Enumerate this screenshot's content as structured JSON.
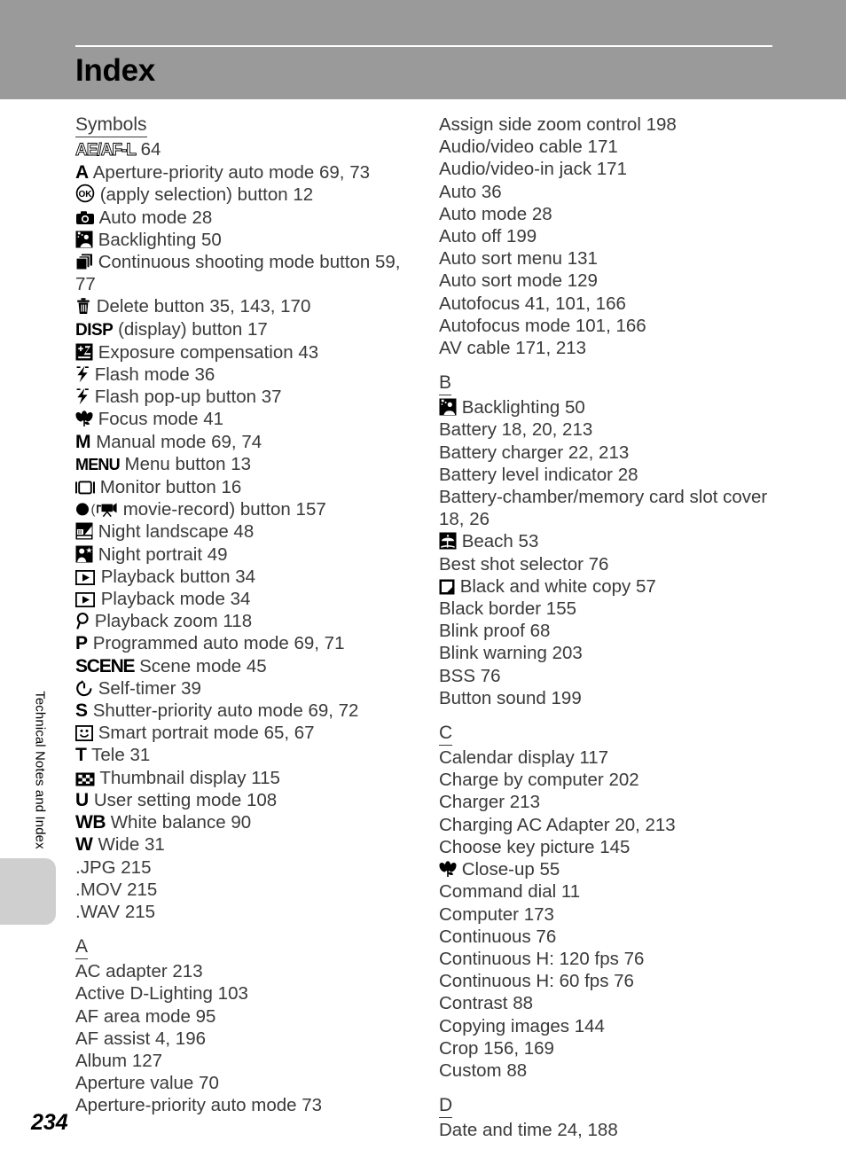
{
  "page": {
    "title": "Index",
    "number": "234",
    "side_tab_label": "Technical Notes and Index",
    "header_bg": "#9a9a9a",
    "text_color": "#3a3a3a",
    "tab_color": "#cfcfcf"
  },
  "left_column": {
    "headings": {
      "symbols": "Symbols",
      "a": "A"
    },
    "symbol_entries": [
      {
        "icon": "ae-af-l-icon",
        "label": "",
        "pages": "64"
      },
      {
        "icon": "letter-a-icon",
        "label": "Aperture-priority auto mode",
        "pages": "69, 73"
      },
      {
        "icon": "ok-button-icon",
        "label": "(apply selection) button",
        "pages": "12"
      },
      {
        "icon": "camera-auto-mode-icon",
        "label": "Auto mode",
        "pages": "28"
      },
      {
        "icon": "backlighting-icon",
        "label": "Backlighting",
        "pages": "50"
      },
      {
        "icon": "continuous-shooting-icon",
        "label": "Continuous shooting mode button",
        "pages": "59, 77"
      },
      {
        "icon": "trash-delete-icon",
        "label": "Delete button",
        "pages": "35, 143, 170"
      },
      {
        "icon": "disp-icon",
        "label": "(display) button",
        "pages": "17"
      },
      {
        "icon": "exposure-compensation-icon",
        "label": "Exposure compensation",
        "pages": "43"
      },
      {
        "icon": "flash-icon",
        "label": "Flash mode",
        "pages": "36"
      },
      {
        "icon": "flash-popup-icon",
        "label": "Flash pop-up button",
        "pages": "37"
      },
      {
        "icon": "macro-flower-icon",
        "label": "Focus mode",
        "pages": "41"
      },
      {
        "icon": "letter-m-icon",
        "label": "Manual mode",
        "pages": "69, 74"
      },
      {
        "icon": "menu-icon",
        "label": "Menu button",
        "pages": "13"
      },
      {
        "icon": "monitor-icon",
        "label": "Monitor button",
        "pages": "16"
      },
      {
        "icon": "movie-record-icon",
        "label": "movie-record) button",
        "pages": "157"
      },
      {
        "icon": "night-landscape-icon",
        "label": "Night landscape",
        "pages": "48"
      },
      {
        "icon": "night-portrait-icon",
        "label": "Night portrait",
        "pages": "49"
      },
      {
        "icon": "playback-icon",
        "label": "Playback button",
        "pages": "34"
      },
      {
        "icon": "playback-icon",
        "label": "Playback mode",
        "pages": "34"
      },
      {
        "icon": "magnifier-zoom-icon",
        "label": "Playback zoom",
        "pages": "118"
      },
      {
        "icon": "letter-p-icon",
        "label": "Programmed auto mode",
        "pages": "69, 71"
      },
      {
        "icon": "scene-icon",
        "label": "Scene mode",
        "pages": "45"
      },
      {
        "icon": "self-timer-icon",
        "label": "Self-timer",
        "pages": "39"
      },
      {
        "icon": "letter-s-icon",
        "label": "Shutter-priority auto mode",
        "pages": "69, 72"
      },
      {
        "icon": "smile-portrait-icon",
        "label": "Smart portrait mode",
        "pages": "65, 67"
      },
      {
        "icon": "letter-t-icon",
        "label": "Tele",
        "pages": "31"
      },
      {
        "icon": "thumbnail-display-icon",
        "label": "Thumbnail display",
        "pages": "115"
      },
      {
        "icon": "letter-u-icon",
        "label": "User setting mode",
        "pages": "108"
      },
      {
        "icon": "wb-icon",
        "label": "White balance",
        "pages": "90"
      },
      {
        "icon": "letter-w-icon",
        "label": "Wide",
        "pages": "31"
      },
      {
        "icon": "",
        "label": ".JPG",
        "pages": "215"
      },
      {
        "icon": "",
        "label": ".MOV",
        "pages": "215"
      },
      {
        "icon": "",
        "label": ".WAV",
        "pages": "215"
      }
    ],
    "a_entries": [
      {
        "label": "AC adapter",
        "pages": "213"
      },
      {
        "label": "Active D-Lighting",
        "pages": "103"
      },
      {
        "label": "AF area mode",
        "pages": "95"
      },
      {
        "label": "AF assist",
        "pages": "4, 196"
      },
      {
        "label": "Album",
        "pages": "127"
      },
      {
        "label": "Aperture value",
        "pages": "70"
      },
      {
        "label": "Aperture-priority auto mode",
        "pages": "73"
      }
    ]
  },
  "right_column": {
    "headings": {
      "b": "B",
      "c": "C",
      "d": "D"
    },
    "a_cont_entries": [
      {
        "label": "Assign side zoom control",
        "pages": "198"
      },
      {
        "label": "Audio/video cable",
        "pages": "171"
      },
      {
        "label": "Audio/video-in jack",
        "pages": "171"
      },
      {
        "label": "Auto",
        "pages": "36"
      },
      {
        "label": "Auto mode",
        "pages": "28"
      },
      {
        "label": "Auto off",
        "pages": "199"
      },
      {
        "label": "Auto sort menu",
        "pages": "131"
      },
      {
        "label": "Auto sort mode",
        "pages": "129"
      },
      {
        "label": "Autofocus",
        "pages": "41, 101, 166"
      },
      {
        "label": "Autofocus mode",
        "pages": "101, 166"
      },
      {
        "label": "AV cable",
        "pages": "171, 213"
      }
    ],
    "b_entries": [
      {
        "label": "Backlighting",
        "icon": "backlighting-icon",
        "pages": "50"
      },
      {
        "label": "Battery",
        "icon": "",
        "pages": "18, 20, 213"
      },
      {
        "label": "Battery charger",
        "icon": "",
        "pages": "22, 213"
      },
      {
        "label": "Battery level indicator",
        "icon": "",
        "pages": "28"
      },
      {
        "label": "Battery-chamber/memory card slot cover",
        "icon": "",
        "pages": "18, 26"
      },
      {
        "label": "Beach",
        "icon": "beach-icon",
        "pages": "53"
      },
      {
        "label": "Best shot selector",
        "icon": "",
        "pages": "76"
      },
      {
        "label": "Black and white copy",
        "icon": "bw-copy-icon",
        "pages": "57"
      },
      {
        "label": "Black border",
        "icon": "",
        "pages": "155"
      },
      {
        "label": "Blink proof",
        "icon": "",
        "pages": "68"
      },
      {
        "label": "Blink warning",
        "icon": "",
        "pages": "203"
      },
      {
        "label": "BSS",
        "icon": "",
        "pages": "76"
      },
      {
        "label": "Button sound",
        "icon": "",
        "pages": "199"
      }
    ],
    "c_entries": [
      {
        "label": "Calendar display",
        "icon": "",
        "pages": "117"
      },
      {
        "label": "Charge by computer",
        "icon": "",
        "pages": "202"
      },
      {
        "label": "Charger",
        "icon": "",
        "pages": "213"
      },
      {
        "label": "Charging AC Adapter",
        "icon": "",
        "pages": "20, 213"
      },
      {
        "label": "Choose key picture",
        "icon": "",
        "pages": "145"
      },
      {
        "label": "Close-up",
        "icon": "macro-flower-icon",
        "pages": "55"
      },
      {
        "label": "Command dial",
        "icon": "",
        "pages": "11"
      },
      {
        "label": "Computer",
        "icon": "",
        "pages": "173"
      },
      {
        "label": "Continuous",
        "icon": "",
        "pages": "76"
      },
      {
        "label": "Continuous H: 120 fps",
        "icon": "",
        "pages": "76"
      },
      {
        "label": "Continuous H: 60 fps",
        "icon": "",
        "pages": "76"
      },
      {
        "label": "Contrast",
        "icon": "",
        "pages": "88"
      },
      {
        "label": "Copying images",
        "icon": "",
        "pages": "144"
      },
      {
        "label": "Crop",
        "icon": "",
        "pages": "156, 169"
      },
      {
        "label": "Custom",
        "icon": "",
        "pages": "88"
      }
    ],
    "d_entries": [
      {
        "label": "Date and time",
        "icon": "",
        "pages": "24, 188"
      }
    ]
  }
}
